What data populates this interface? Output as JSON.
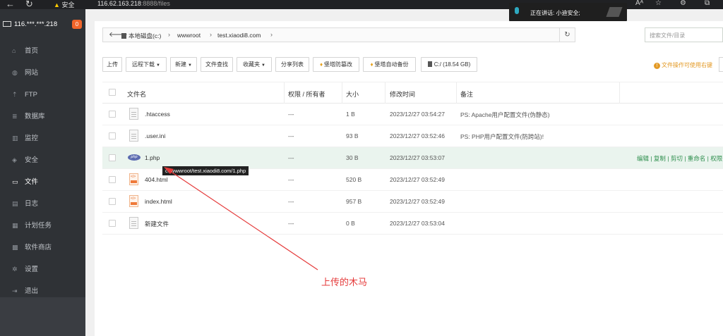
{
  "browser": {
    "url_host": "116.62.163.218",
    "url_rest": ":8888/files",
    "security_text": "安全",
    "voice_popup": "正在讲话:  小迪安全;"
  },
  "sidebar": {
    "server": "116.***.***.218",
    "badge": "0",
    "items": [
      {
        "label": "首页",
        "icon": "home-icon"
      },
      {
        "label": "网站",
        "icon": "globe-icon"
      },
      {
        "label": "FTP",
        "icon": "ftp-icon"
      },
      {
        "label": "数据库",
        "icon": "database-icon"
      },
      {
        "label": "监控",
        "icon": "monitor-icon"
      },
      {
        "label": "安全",
        "icon": "shield-icon"
      },
      {
        "label": "文件",
        "icon": "folder-icon"
      },
      {
        "label": "日志",
        "icon": "log-icon"
      },
      {
        "label": "计划任务",
        "icon": "calendar-icon"
      },
      {
        "label": "软件商店",
        "icon": "apps-icon"
      },
      {
        "label": "设置",
        "icon": "gear-icon"
      },
      {
        "label": "退出",
        "icon": "logout-icon"
      }
    ],
    "active": "文件"
  },
  "path": {
    "crumbs": [
      "本地磁盘(c:)",
      "wwwroot",
      "test.xiaodi8.com"
    ],
    "search_placeholder": "搜索文件/目录"
  },
  "toolbar": {
    "upload": "上传",
    "remote_download": "远程下载",
    "new": "新建",
    "file_search": "文件查找",
    "favorites": "收藏夹",
    "share_list": "分享列表",
    "tamper_proof": "堡塔防篡改",
    "auto_backup": "堡塔自动备份",
    "disk": "C:/ (18.54 GB)",
    "tip": "文件操作可使用右键"
  },
  "table": {
    "headers": {
      "name": "文件名",
      "perm": "权限 / 所有者",
      "size": "大小",
      "mtime": "修改时间",
      "note": "备注"
    },
    "rows": [
      {
        "name": ".htaccess",
        "perm": "---",
        "size": "1 B",
        "mtime": "2023/12/27 03:54:27",
        "note": "PS: Apache用户配置文件(伪静态)",
        "type": "doc"
      },
      {
        "name": ".user.ini",
        "perm": "---",
        "size": "93 B",
        "mtime": "2023/12/27 03:52:46",
        "note": "PS: PHP用户配置文件(防跨站)!",
        "type": "doc"
      },
      {
        "name": "1.php",
        "perm": "---",
        "size": "30 B",
        "mtime": "2023/12/27 03:53:07",
        "note": "",
        "type": "php"
      },
      {
        "name": "404.html",
        "perm": "---",
        "size": "520 B",
        "mtime": "2023/12/27 03:52:49",
        "note": "",
        "type": "html"
      },
      {
        "name": "index.html",
        "perm": "---",
        "size": "957 B",
        "mtime": "2023/12/27 03:52:49",
        "note": "",
        "type": "html"
      },
      {
        "name": "新建文件",
        "perm": "---",
        "size": "0 B",
        "mtime": "2023/12/27 03:53:04",
        "note": "",
        "type": "doc"
      }
    ],
    "row_ops": "编辑 | 复制 | 剪切 | 重命名 | 权限"
  },
  "tooltip": "c:/wwwroot/test.xiaodi8.com/1.php",
  "annotation": "上传的木马"
}
